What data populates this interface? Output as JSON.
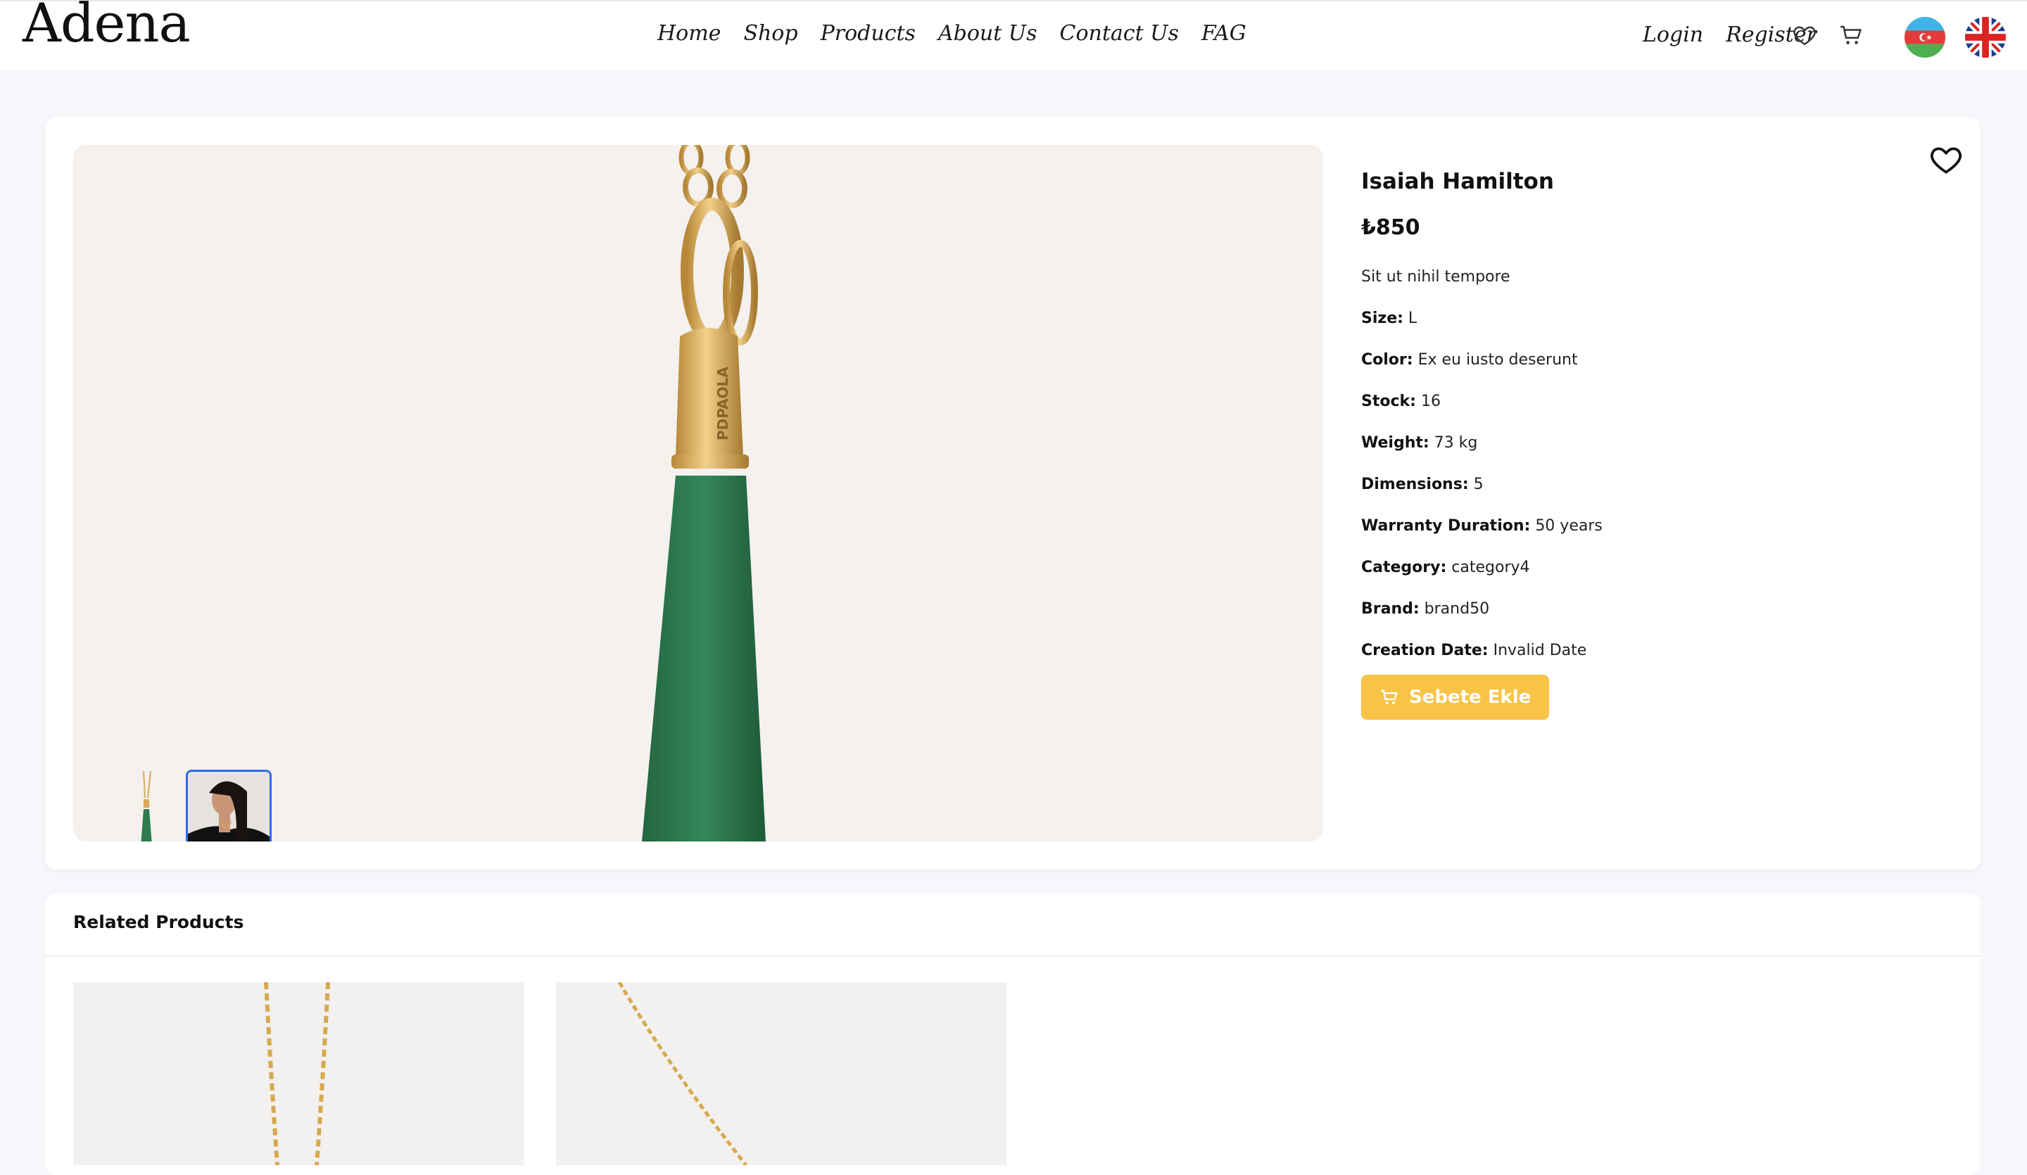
{
  "brand": {
    "logo_text": "Adena"
  },
  "nav": {
    "items": [
      "Home",
      "Shop",
      "Products",
      "About Us",
      "Contact Us",
      "FAG"
    ]
  },
  "auth": {
    "login": "Login",
    "register": "Register"
  },
  "header_icons": [
    "heart-icon",
    "cart-icon"
  ],
  "languages": [
    "az-flag",
    "uk-flag"
  ],
  "product": {
    "title": "Isaiah Hamilton",
    "price": "₺850",
    "description": "Sit ut nihil tempore",
    "specs": [
      {
        "label": "Size:",
        "value": "L"
      },
      {
        "label": "Color:",
        "value": "Ex eu iusto deserunt"
      },
      {
        "label": "Stock:",
        "value": "16"
      },
      {
        "label": "Weight:",
        "value": "73 kg"
      },
      {
        "label": "Dimensions:",
        "value": "5"
      },
      {
        "label": "Warranty Duration:",
        "value": "50 years"
      },
      {
        "label": "Category:",
        "value": "category4"
      },
      {
        "label": "Brand:",
        "value": "brand50"
      },
      {
        "label": "Creation Date:",
        "value": "Invalid Date"
      }
    ],
    "add_to_cart": "Sebete Ekle",
    "pendant_engraving": "PDPAOLA"
  },
  "related": {
    "title": "Related Products"
  },
  "colors": {
    "accent": "#f8c347",
    "gallery_bg": "#f4f1ee",
    "page_bg": "#f6f7fb",
    "selected_thumb_border": "#2f6de0",
    "gem_green": "#2f7a4e",
    "gold": "#d8aa5a"
  }
}
